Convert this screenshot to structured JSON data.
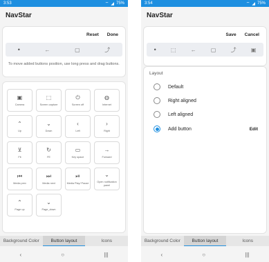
{
  "left": {
    "status": {
      "time": "3:53",
      "battery": "75%"
    },
    "app_title": "NavStar",
    "actions": {
      "reset": "Reset",
      "done": "Done"
    },
    "preview_icons": [
      "dot",
      "back",
      "home",
      "recents"
    ],
    "hint": "To move added buttons position, use long press and drag buttons.",
    "buttons": [
      {
        "label": "Camera",
        "icon": "camera-icon",
        "glyph": "▣"
      },
      {
        "label": "Screen capture",
        "icon": "screen-capture-icon",
        "glyph": "⬚"
      },
      {
        "label": "Screen off",
        "icon": "power-icon",
        "glyph": "⏻"
      },
      {
        "label": "Internet",
        "icon": "globe-icon",
        "glyph": "◍"
      },
      {
        "label": "Up",
        "icon": "chevron-up-icon",
        "glyph": "⌃"
      },
      {
        "label": "Down",
        "icon": "chevron-down-icon",
        "glyph": "⌄"
      },
      {
        "label": "Left",
        "icon": "chevron-left-icon",
        "glyph": "‹"
      },
      {
        "label": "Right",
        "icon": "chevron-right-icon",
        "glyph": "›"
      },
      {
        "label": "Fit",
        "icon": "fit-icon",
        "glyph": "⊻"
      },
      {
        "label": "FE",
        "icon": "refresh-icon",
        "glyph": "↻"
      },
      {
        "label": "Key space",
        "icon": "keyboard-icon",
        "glyph": "▭"
      },
      {
        "label": "Forward",
        "icon": "arrow-forward-icon",
        "glyph": "→"
      },
      {
        "label": "Media prev",
        "icon": "media-prev-icon",
        "glyph": "⏮"
      },
      {
        "label": "Media next",
        "icon": "media-next-icon",
        "glyph": "⏭"
      },
      {
        "label": "Media Play/ Pause",
        "icon": "play-pause-icon",
        "glyph": "⏯"
      },
      {
        "label": "Open notification panel",
        "icon": "notification-panel-icon",
        "glyph": "⌄"
      },
      {
        "label": "Page up",
        "icon": "page-up-icon",
        "glyph": "⌃"
      },
      {
        "label": "Page_down",
        "icon": "page-down-icon",
        "glyph": "⌄"
      }
    ],
    "tabs": [
      "Background Color",
      "Button layout",
      "Icons"
    ]
  },
  "right": {
    "status": {
      "time": "3:54",
      "battery": "75%"
    },
    "app_title": "NavStar",
    "actions": {
      "save": "Save",
      "cancel": "Cancel"
    },
    "layout_title": "Layout",
    "options": [
      {
        "label": "Default",
        "selected": false
      },
      {
        "label": "Right aligned",
        "selected": false
      },
      {
        "label": "Left aligned",
        "selected": false
      },
      {
        "label": "Add button",
        "selected": true,
        "edit": "Edit"
      }
    ],
    "tabs": [
      "Background Color",
      "Button layout",
      "Icons"
    ]
  },
  "accent_color": "#1e8fe0"
}
